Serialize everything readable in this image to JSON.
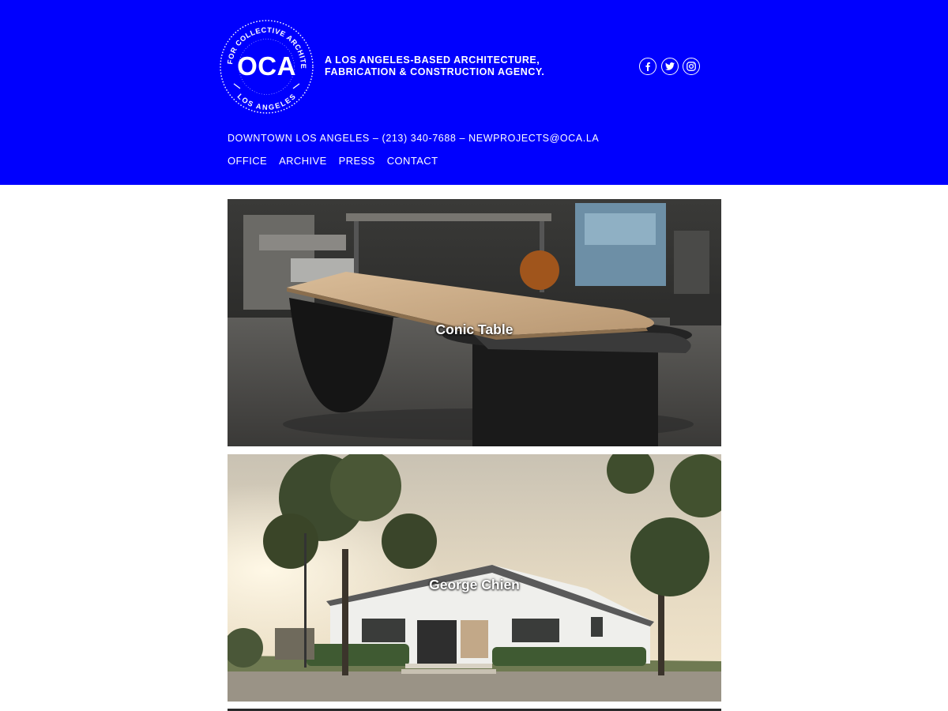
{
  "brand": {
    "logo_text": "OCA",
    "logo_ring_top": "OFFICE FOR COLLECTIVE ARCHITECTURE",
    "logo_ring_bottom": "LOS ANGELES",
    "tagline_line1": "A LOS ANGELES-BASED ARCHITECTURE,",
    "tagline_line2": "FABRICATION & CONSTRUCTION AGENCY."
  },
  "social": [
    {
      "icon": "facebook-icon"
    },
    {
      "icon": "twitter-icon"
    },
    {
      "icon": "instagram-icon"
    }
  ],
  "contact_line": "DOWNTOWN LOS ANGELES – (213) 340-7688 – NEWPROJECTS@OCA.LA",
  "nav": {
    "items": [
      {
        "label": "OFFICE"
      },
      {
        "label": "ARCHIVE"
      },
      {
        "label": "PRESS"
      },
      {
        "label": "CONTACT"
      }
    ]
  },
  "projects": [
    {
      "title": "Conic Table"
    },
    {
      "title": "George Chien"
    }
  ],
  "colors": {
    "header_bg": "#0000fe",
    "text_on_header": "#ffffff",
    "page_bg": "#ffffff"
  }
}
